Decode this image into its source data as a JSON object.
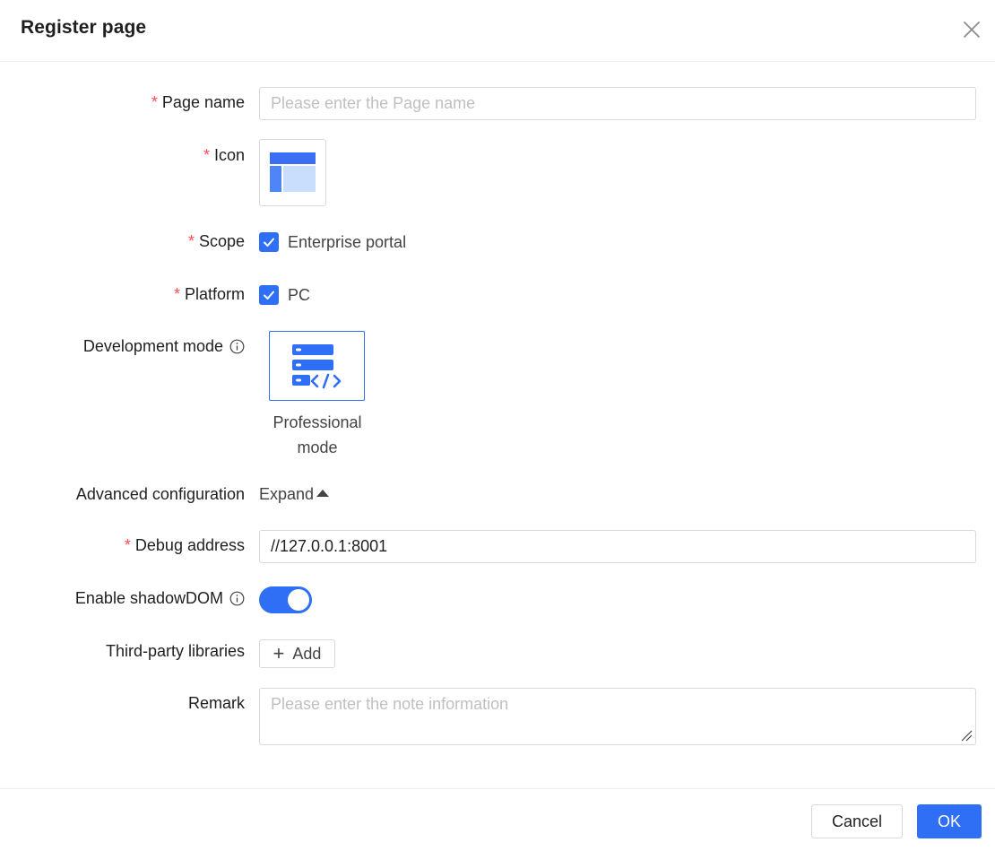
{
  "dialog": {
    "title": "Register page"
  },
  "form": {
    "page_name": {
      "label": "Page name",
      "required": "*",
      "placeholder": "Please enter the Page name",
      "value": ""
    },
    "icon": {
      "label": "Icon",
      "required": "*"
    },
    "scope": {
      "label": "Scope",
      "required": "*",
      "option": "Enterprise portal",
      "checked": true
    },
    "platform": {
      "label": "Platform",
      "required": "*",
      "option": "PC",
      "checked": true
    },
    "development_mode": {
      "label": "Development mode",
      "selected": "Professional mode",
      "option_line1": "Professional",
      "option_line2": "mode"
    },
    "advanced": {
      "label": "Advanced configuration",
      "toggle_text": "Expand"
    },
    "debug_address": {
      "label": "Debug address",
      "required": "*",
      "value": "//127.0.0.1:8001"
    },
    "shadow_dom": {
      "label": "Enable shadowDOM",
      "enabled": true
    },
    "libraries": {
      "label": "Third-party libraries",
      "add_label": "Add"
    },
    "remark": {
      "label": "Remark",
      "placeholder": "Please enter the note information",
      "value": ""
    }
  },
  "footer": {
    "cancel_label": "Cancel",
    "ok_label": "OK"
  },
  "colors": {
    "primary": "#2f6ff5",
    "required": "#ff4d4f",
    "border": "#d9d9d9"
  },
  "icons": {
    "close": "close-icon",
    "info": "info-circle-icon",
    "page_layout": "page-layout-icon",
    "professional_mode": "code-server-icon",
    "check": "check-icon",
    "plus": "plus-icon"
  }
}
